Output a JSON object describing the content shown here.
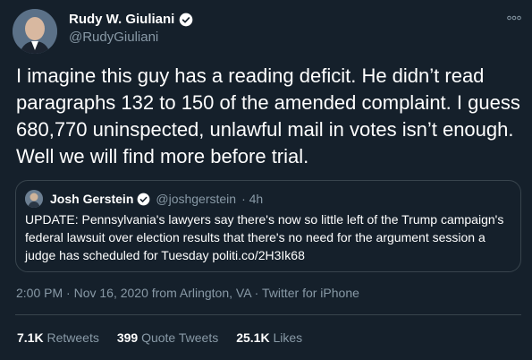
{
  "author": {
    "name": "Rudy W. Giuliani",
    "handle": "@RudyGiuliani"
  },
  "tweet": {
    "text": "I imagine this guy has a reading deficit. He didn’t read paragraphs 132 to 150 of the amended complaint. I guess 680,770 uninspected, unlawful mail in votes isn’t enough. Well we will find more before trial."
  },
  "quoted": {
    "name": "Josh Gerstein",
    "handle": "@joshgerstein",
    "time": "· 4h",
    "text": "UPDATE: Pennsylvania's lawyers say there's now so little left of the Trump campaign's federal lawsuit over election results that there's no need for the argument session a judge has scheduled for Tuesday politi.co/2H3Ik68"
  },
  "meta": {
    "text": "2:00 PM · Nov 16, 2020 from Arlington, VA · Twitter for iPhone"
  },
  "stats": {
    "retweets_count": "7.1K",
    "retweets_label": "Retweets",
    "quotes_count": "399",
    "quotes_label": "Quote Tweets",
    "likes_count": "25.1K",
    "likes_label": "Likes"
  },
  "colors": {
    "background": "#15202b",
    "secondary_text": "#8899a6",
    "verified_blue": "#1da1f2",
    "border": "#38444d"
  }
}
